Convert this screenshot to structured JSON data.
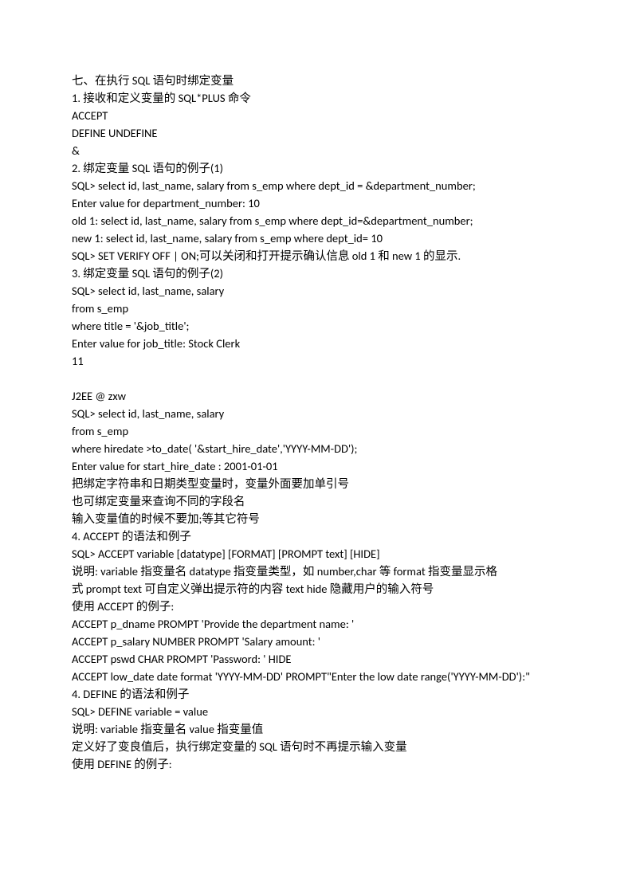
{
  "lines": [
    "七、在执行 SQL 语句时绑定变量",
    "1. 接收和定义变量的 SQL*PLUS 命令",
    "ACCEPT",
    "DEFINE UNDEFINE",
    "&",
    "2. 绑定变量 SQL 语句的例子(1)",
    "SQL> select id, last_name, salary from s_emp where dept_id = &department_number;",
    "Enter value for department_number: 10",
    "old 1: select id, last_name, salary from s_emp where dept_id=&department_number;",
    "new 1: select id, last_name, salary from s_emp where dept_id= 10",
    "SQL> SET VERIFY OFF | ON;可以关闭和打开提示确认信息 old 1 和 new 1 的显示.",
    "3. 绑定变量 SQL 语句的例子(2)",
    "SQL> select id, last_name, salary",
    "from s_emp",
    "where title = '&job_title';",
    "Enter value for job_title: Stock Clerk",
    "11",
    "",
    "J2EE @ zxw",
    "SQL> select id, last_name, salary",
    "from s_emp",
    "where hiredate >to_date( '&start_hire_date','YYYY-MM-DD');",
    "Enter value for start_hire_date : 2001-01-01",
    "把绑定字符串和日期类型变量时，变量外面要加单引号",
    "也可绑定变量来查询不同的字段名",
    "输入变量值的时候不要加;等其它符号",
    "4. ACCEPT 的语法和例子",
    "SQL> ACCEPT variable [datatype] [FORMAT] [PROMPT text] [HIDE]",
    "说明: variable 指变量名 datatype 指变量类型，如 number,char 等 format 指变量显示格",
    "式 prompt text 可自定义弹出提示符的内容 text hide 隐藏用户的输入符号",
    "使用 ACCEPT 的例子:",
    "ACCEPT p_dname PROMPT 'Provide the department name: '",
    "ACCEPT p_salary NUMBER PROMPT 'Salary amount: '",
    "ACCEPT pswd CHAR PROMPT 'Password: ' HIDE",
    "ACCEPT low_date date format 'YYYY-MM-DD' PROMPT\"Enter the low date range('YYYY-MM-DD'):\"",
    "4. DEFINE 的语法和例子",
    "SQL> DEFINE variable = value",
    "说明: variable 指变量名 value 指变量值",
    "定义好了变良值后，执行绑定变量的 SQL 语句时不再提示输入变量",
    "使用 DEFINE 的例子:"
  ]
}
